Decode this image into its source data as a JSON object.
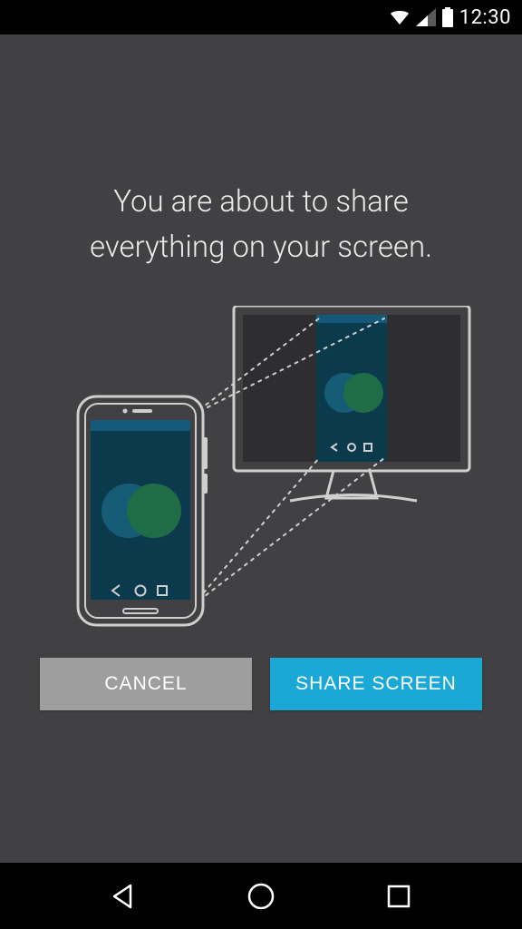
{
  "status_bar": {
    "time": "12:30"
  },
  "heading": "You are about to share everything on your screen.",
  "buttons": {
    "cancel": "CANCEL",
    "share": "SHARE SCREEN"
  }
}
